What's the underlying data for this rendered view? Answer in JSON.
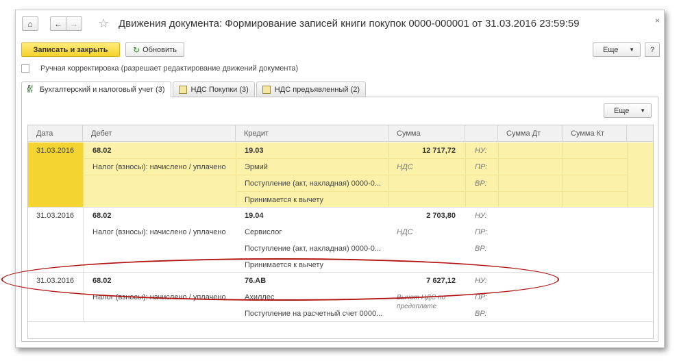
{
  "window": {
    "title": "Движения документа: Формирование записей книги покупок 0000-000001 от 31.03.2016 23:59:59",
    "close": "×"
  },
  "nav": {
    "home": "⌂",
    "back": "←",
    "forward": "→",
    "star": "☆"
  },
  "toolbar": {
    "save_close": "Записать и закрыть",
    "refresh": "Обновить",
    "more": "Еще",
    "help": "?"
  },
  "manual_edit": {
    "label": "Ручная корректировка (разрешает редактирование движений документа)",
    "checked": false
  },
  "tabs": [
    {
      "label": "Бухгалтерский и налоговый учет (3)",
      "icon": "dt-kt-icon",
      "active": true
    },
    {
      "label": "НДС Покупки (3)",
      "icon": "register-icon",
      "active": false
    },
    {
      "label": "НДС предъявленный (2)",
      "icon": "register-icon",
      "active": false
    }
  ],
  "panel": {
    "more": "Еще"
  },
  "table": {
    "headers": [
      "Дата",
      "Дебет",
      "Кредит",
      "Сумма",
      "",
      "Сумма Дт",
      "Сумма Кт"
    ],
    "rows": [
      {
        "date": "31.03.2016",
        "debit": [
          "68.02",
          "Налог (взносы): начислено / уплачено"
        ],
        "credit": [
          "19.03",
          "Эрмий",
          "Поступление (акт, накладная) 0000-0...",
          "Принимается к вычету"
        ],
        "sum": "12 717,72",
        "sum_note": "НДС",
        "flags": [
          "НУ:",
          "ПР:",
          "ВР:"
        ]
      },
      {
        "date": "31.03.2016",
        "debit": [
          "68.02",
          "Налог (взносы): начислено / уплачено"
        ],
        "credit": [
          "19.04",
          "Сервислог",
          "Поступление (акт, накладная) 0000-0...",
          "Принимается к вычету"
        ],
        "sum": "2 703,80",
        "sum_note": "НДС",
        "flags": [
          "НУ:",
          "ПР:",
          "ВР:"
        ]
      },
      {
        "date": "31.03.2016",
        "debit": [
          "68.02",
          "Налог (взносы): начислено / уплачено"
        ],
        "credit": [
          "76.АВ",
          "Ахиллес",
          "Поступление на расчетный счет 0000..."
        ],
        "sum": "7 627,12",
        "sum_note": "Вычет НДС по предоплате",
        "flags": [
          "НУ:",
          "ПР:",
          "ВР:"
        ]
      }
    ]
  }
}
